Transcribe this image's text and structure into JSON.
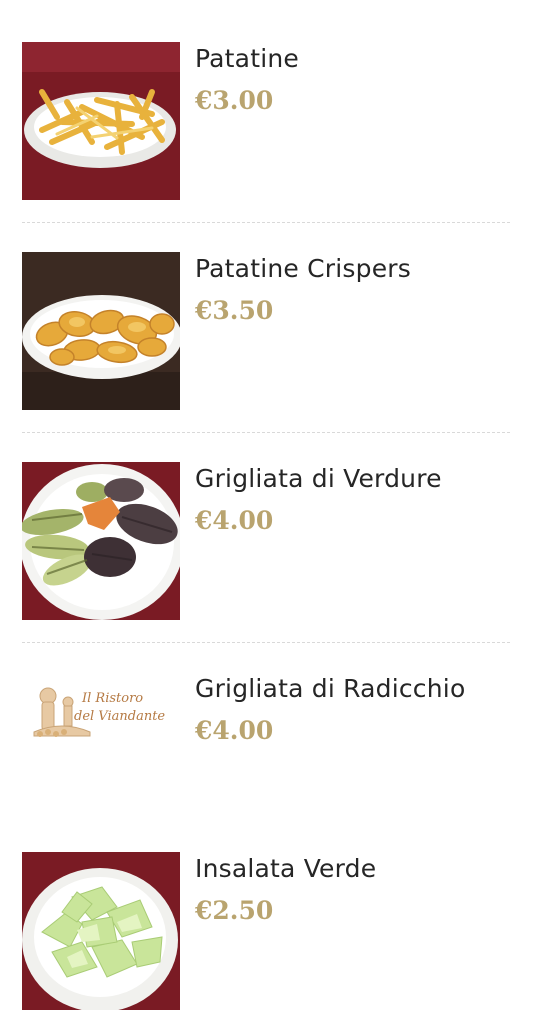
{
  "menu": {
    "items": [
      {
        "name": "Patatine",
        "price": "€3.00",
        "image": "fries-photo"
      },
      {
        "name": "Patatine Crispers",
        "price": "€3.50",
        "image": "crispers-photo"
      },
      {
        "name": "Grigliata di Verdure",
        "price": "€4.00",
        "image": "grilled-vegetables-photo"
      },
      {
        "name": "Grigliata di Radicchio",
        "price": "€4.00",
        "image": "restaurant-logo-placeholder",
        "logo_text": [
          "Il Ristoro",
          "del Viandante"
        ]
      },
      {
        "name": "Insalata Verde",
        "price": "€2.50",
        "image": "green-salad-photo"
      }
    ]
  },
  "colors": {
    "price": "#b9a46f",
    "name": "#262626",
    "divider": "#d9d9d9"
  }
}
